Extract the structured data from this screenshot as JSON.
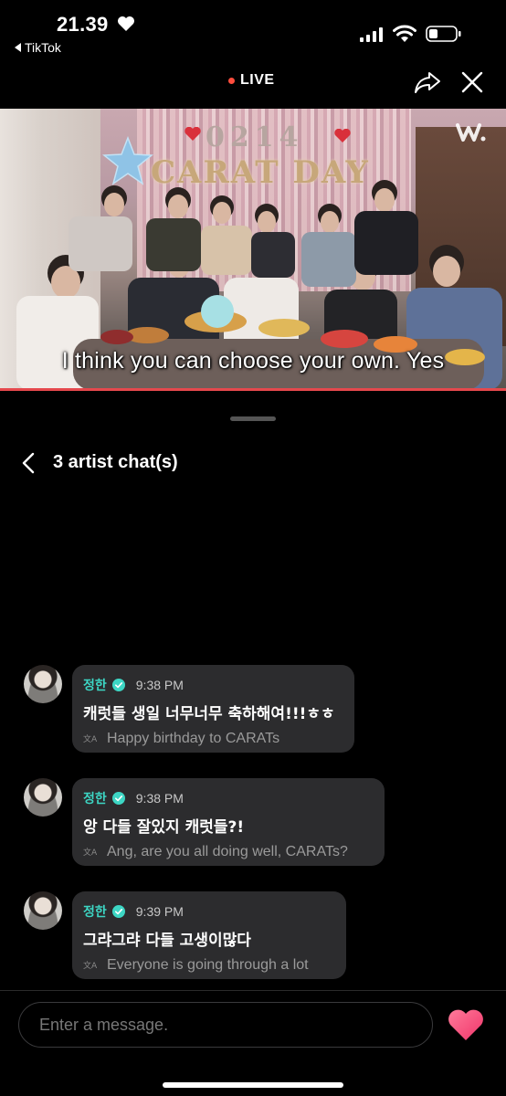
{
  "status_bar": {
    "time": "21.39",
    "back_app": "TikTok",
    "icons": [
      "heart-icon",
      "signal-icon",
      "wifi-icon",
      "battery-icon"
    ]
  },
  "live_header": {
    "live_label": "LIVE",
    "live_color": "#ff4d3d",
    "icons": [
      "share-icon",
      "close-icon"
    ]
  },
  "video": {
    "banner_text": "CARAT DAY",
    "banner_number": "0214",
    "subtitle": "I think you can choose your own. Yes",
    "progress_color": "#e5484d"
  },
  "chat": {
    "title": "3 artist chat(s)",
    "messages": [
      {
        "name": "정한",
        "time": "9:38 PM",
        "text": "캐럿들 생일 너무너무 축하해여!!!ㅎㅎ",
        "translation": "Happy birthday to CARATs"
      },
      {
        "name": "정한",
        "time": "9:38 PM",
        "text": "앙 다들 잘있지 캐럿들?!",
        "translation": "Ang, are you all doing well, CARATs?"
      },
      {
        "name": "정한",
        "time": "9:39 PM",
        "text": "그랴그랴 다들 고생이많다",
        "translation": "Everyone is going through a lot"
      }
    ],
    "name_color": "#3dd6c4",
    "bubble_color": "#2c2c2e"
  },
  "input": {
    "placeholder": "Enter a message.",
    "like_color": "#ff4f7b"
  }
}
